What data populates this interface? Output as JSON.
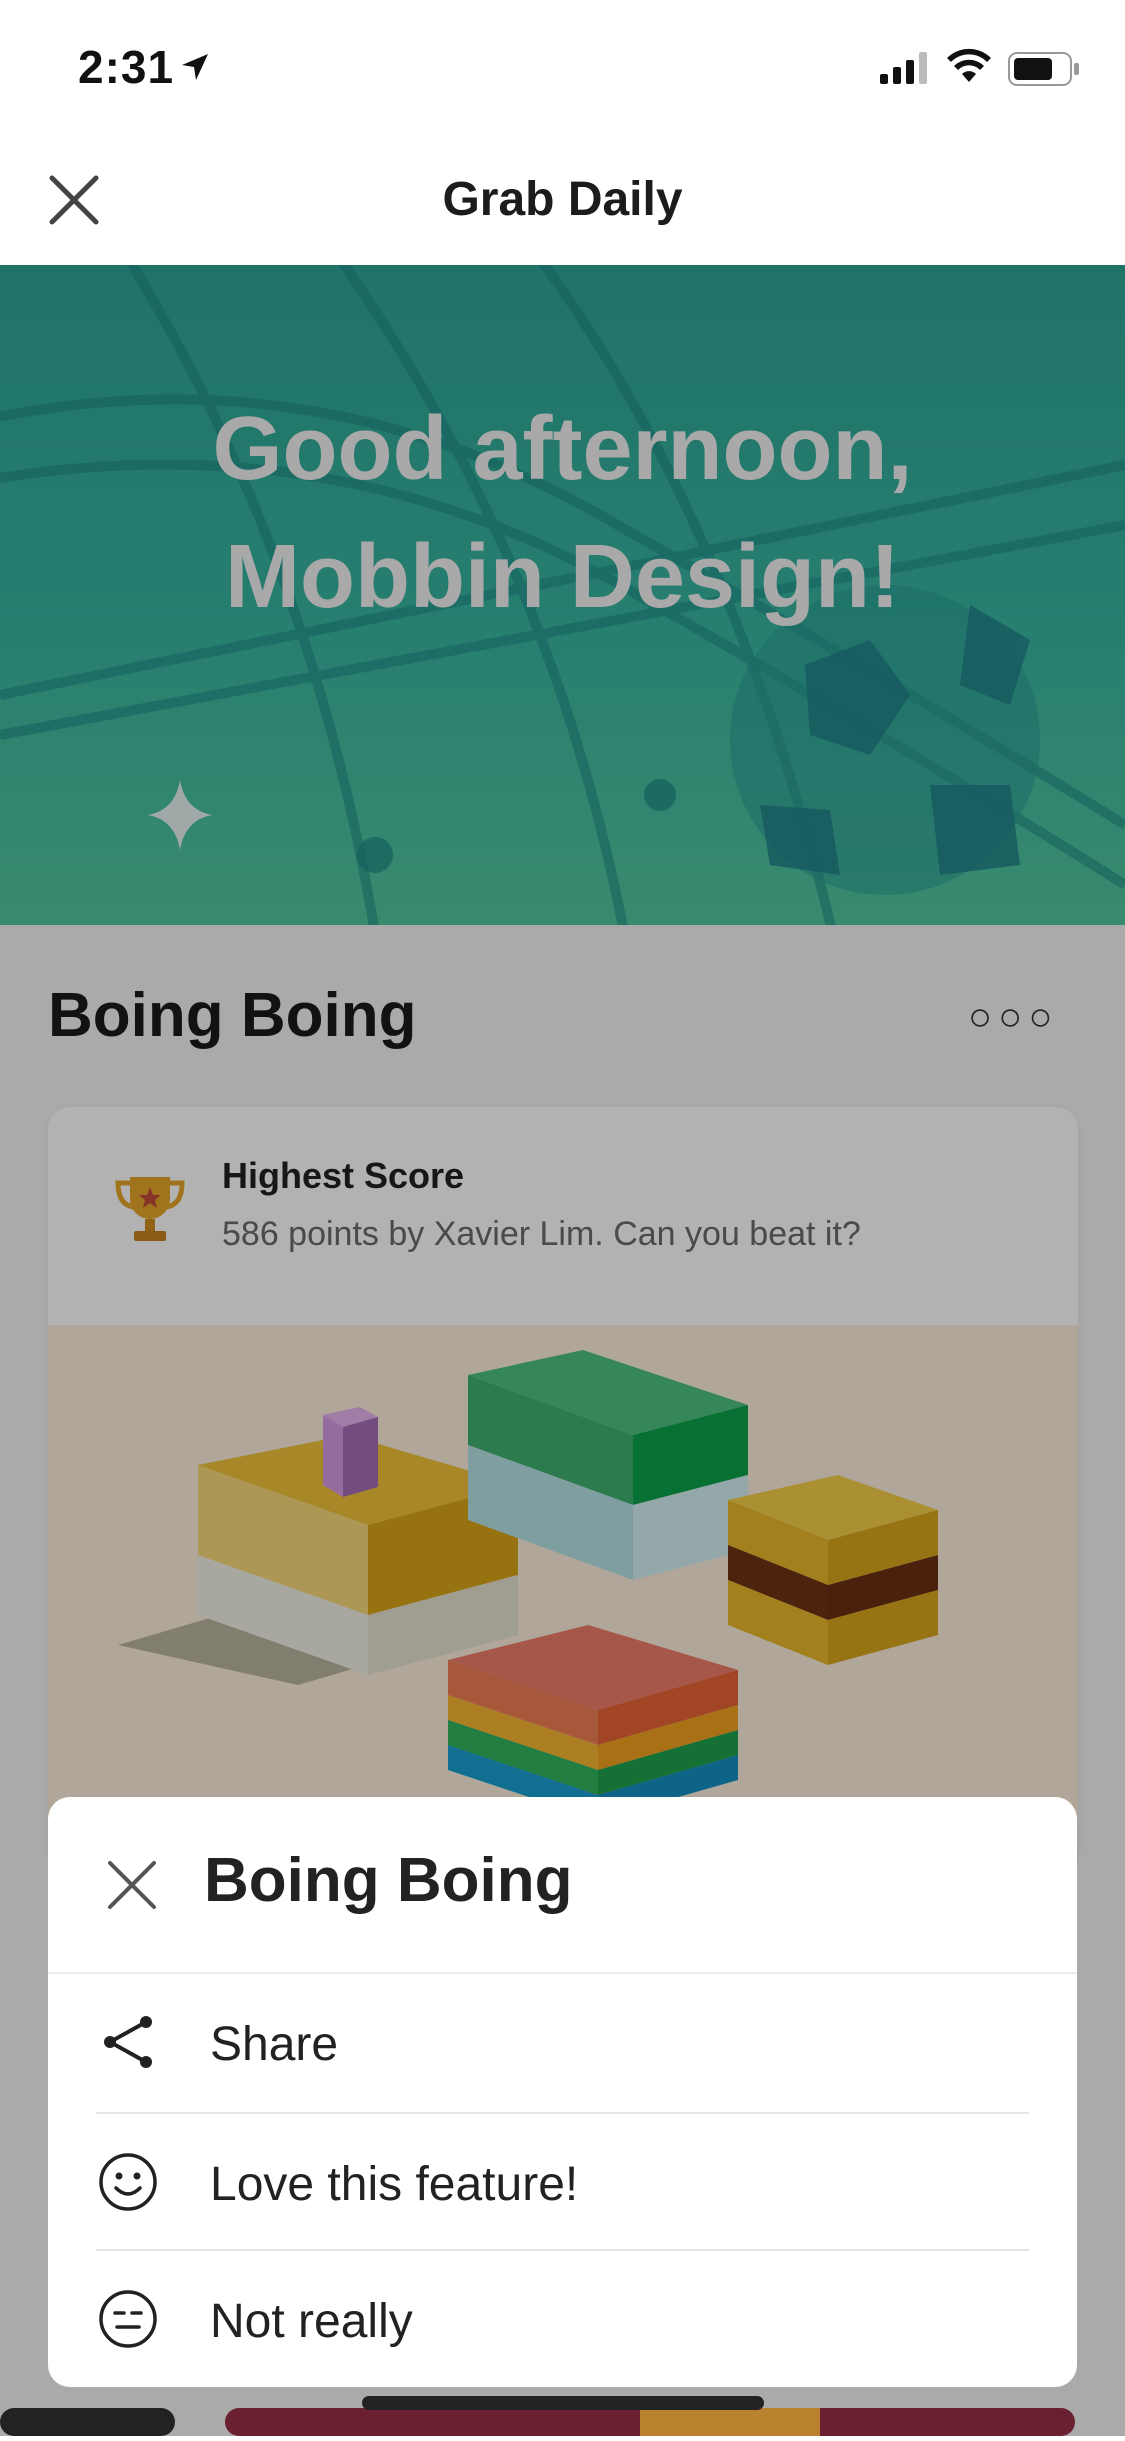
{
  "status_bar": {
    "time": "2:31"
  },
  "nav": {
    "title": "Grab Daily"
  },
  "hero": {
    "line1": "Good afternoon,",
    "line2": "Mobbin Design!"
  },
  "section": {
    "title": "Boing Boing",
    "more": "○○○"
  },
  "card": {
    "score_title": "Highest Score",
    "score_desc": "586 points by Xavier Lim. Can you beat it?"
  },
  "sheet": {
    "title": "Boing Boing",
    "items": [
      {
        "label": "Share",
        "icon": "share-icon"
      },
      {
        "label": "Love this feature!",
        "icon": "smile-icon"
      },
      {
        "label": "Not really",
        "icon": "neutral-face-icon"
      }
    ]
  },
  "colors": {
    "hero_top": "#2fa596",
    "hero_bottom": "#52c79e",
    "trophy": "#e5a52a"
  }
}
